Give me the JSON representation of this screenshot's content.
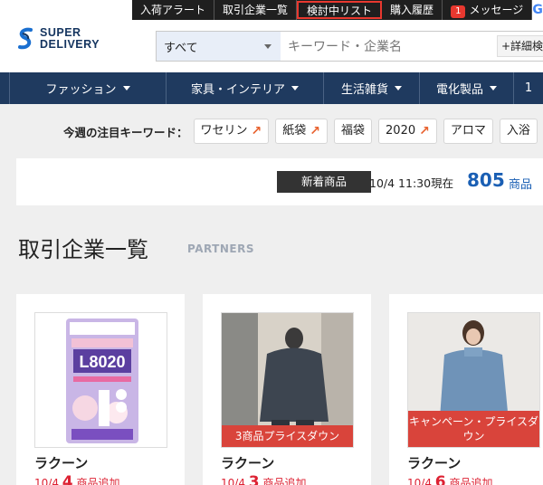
{
  "topbar": {
    "links": [
      "入荷アラート",
      "取引企業一覧",
      "検討中リスト",
      "購入履歴",
      "メッセージ"
    ],
    "message_count": "1",
    "g_letter": "G"
  },
  "logo": {
    "line1": "SUPER",
    "line2": "DELIVERY"
  },
  "search": {
    "category": "すべて",
    "placeholder": "キーワード・企業名",
    "detail": "+詳細検"
  },
  "nav": {
    "items": [
      "ファッション",
      "家具・インテリア",
      "生活雑貨",
      "電化製品",
      "1"
    ]
  },
  "keywords": {
    "label": "今週の注目キーワード：",
    "chips": [
      {
        "text": "ワセリン",
        "trend": true
      },
      {
        "text": "紙袋",
        "trend": true
      },
      {
        "text": "福袋",
        "trend": false
      },
      {
        "text": "2020",
        "trend": true
      },
      {
        "text": "アロマ",
        "trend": false
      },
      {
        "text": "入浴",
        "trend": false
      }
    ],
    "arrow": "↗"
  },
  "newitems": {
    "label": "新着商品",
    "date": "10/4 11:30現在",
    "count": "805",
    "unit": "商品"
  },
  "partners": {
    "title": "取引企業一覧",
    "subtitle": "PARTNERS"
  },
  "cards": [
    {
      "name": "ラクーン",
      "banner": "",
      "meta_pre": "10/4",
      "meta_num": "4",
      "meta_post": "商品追加",
      "product_text": "L8020"
    },
    {
      "name": "ラクーン",
      "banner": "3商品プライスダウン",
      "meta_pre": "10/4",
      "meta_num": "3",
      "meta_post": "商品追加"
    },
    {
      "name": "ラクーン",
      "banner": "キャンペーン・プライスダウン",
      "meta_pre": "10/4",
      "meta_num": "6",
      "meta_post": "商品追加"
    }
  ],
  "colors": {
    "nav_bg": "#1f3a5f",
    "accent_red": "#e8382f",
    "link_blue": "#1a5fb4",
    "banner_red": "#d9443b"
  }
}
